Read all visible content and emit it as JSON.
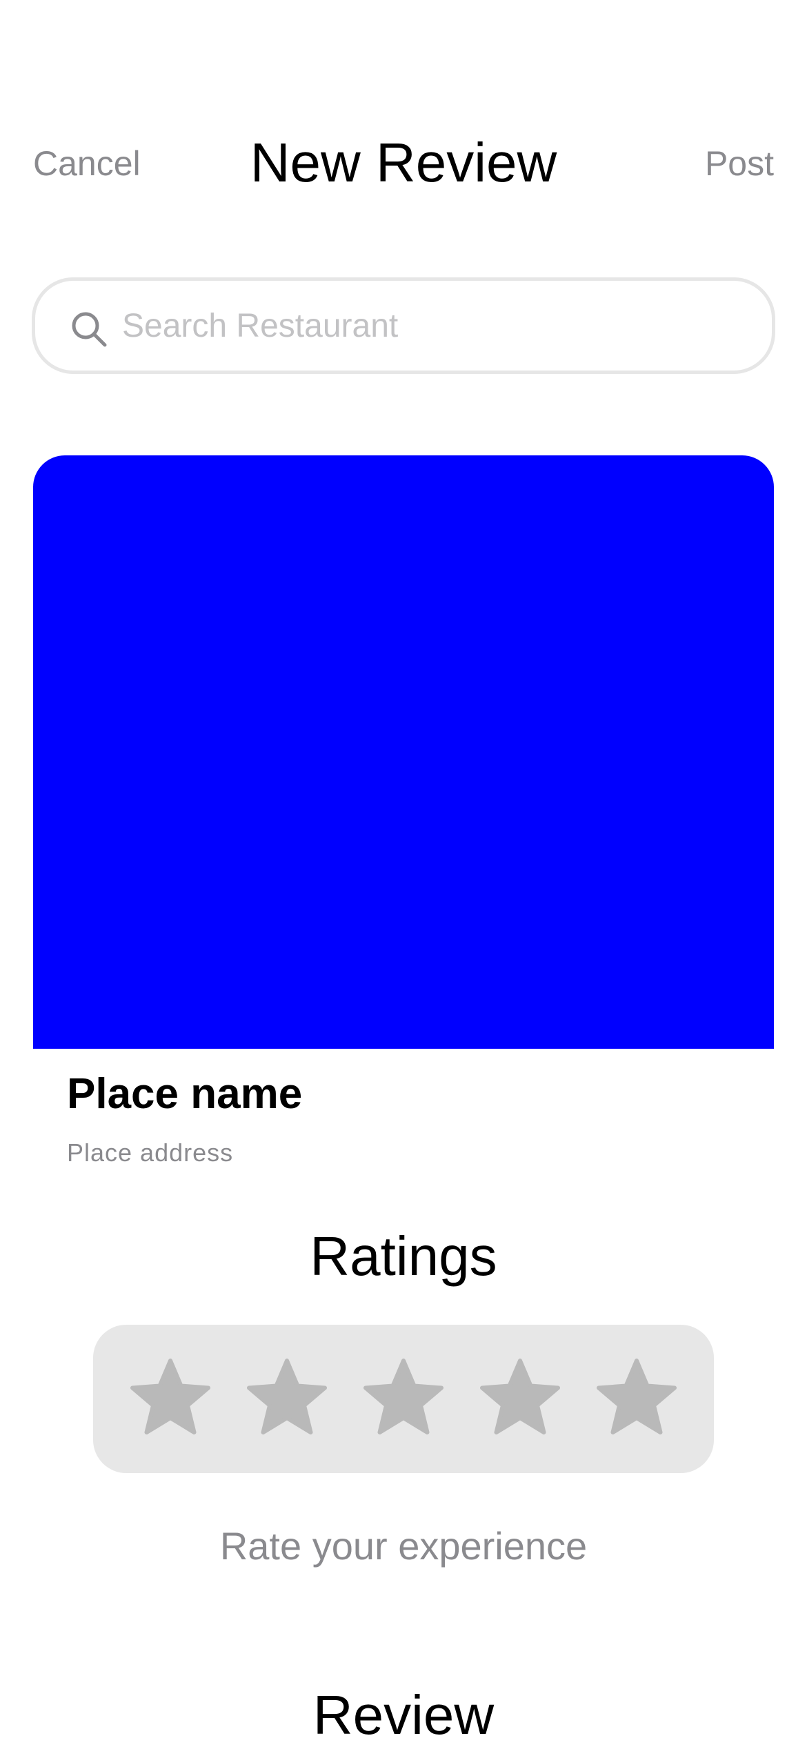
{
  "header": {
    "cancel_label": "Cancel",
    "title": "New Review",
    "post_label": "Post"
  },
  "search": {
    "placeholder": "Search Restaurant",
    "value": "",
    "icon": "search-icon"
  },
  "place": {
    "image_color": "#0000ff",
    "name": "Place name",
    "address": "Place address"
  },
  "ratings": {
    "title": "Ratings",
    "rating": 0,
    "max_rating": 5,
    "star_icon": "star-icon",
    "star_color": "#b9b9b9",
    "caption": "Rate your experience"
  },
  "review": {
    "title": "Review"
  }
}
